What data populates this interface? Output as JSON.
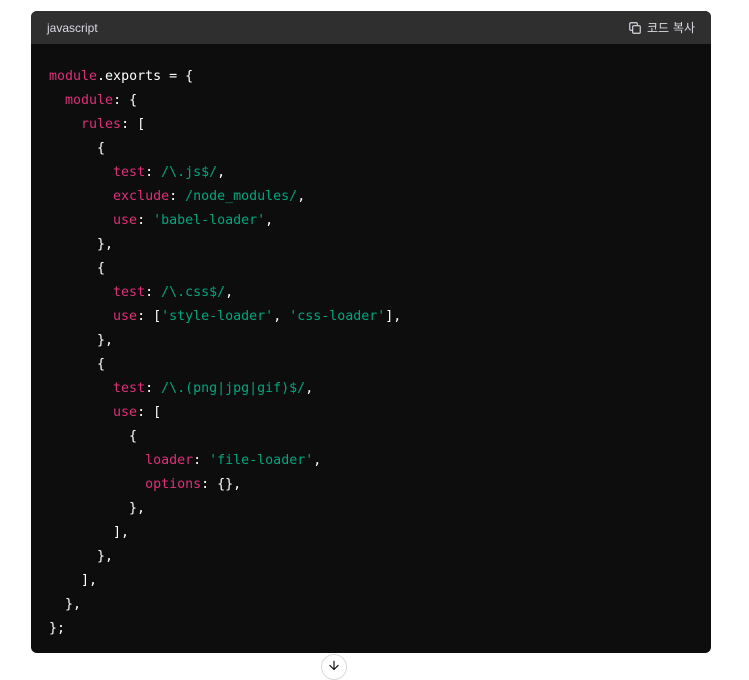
{
  "code_block": {
    "language": "javascript",
    "copy_label": "코드 복사",
    "lines": [
      [
        {
          "t": "prop",
          "v": "module"
        },
        {
          "t": "plain",
          "v": ".exports = {"
        }
      ],
      [
        {
          "t": "plain",
          "v": "  "
        },
        {
          "t": "prop",
          "v": "module"
        },
        {
          "t": "plain",
          "v": ": {"
        }
      ],
      [
        {
          "t": "plain",
          "v": "    "
        },
        {
          "t": "prop",
          "v": "rules"
        },
        {
          "t": "plain",
          "v": ": ["
        }
      ],
      [
        {
          "t": "plain",
          "v": "      {"
        }
      ],
      [
        {
          "t": "plain",
          "v": "        "
        },
        {
          "t": "prop",
          "v": "test"
        },
        {
          "t": "plain",
          "v": ": "
        },
        {
          "t": "str",
          "v": "/\\.js$/"
        },
        {
          "t": "plain",
          "v": ","
        }
      ],
      [
        {
          "t": "plain",
          "v": "        "
        },
        {
          "t": "prop",
          "v": "exclude"
        },
        {
          "t": "plain",
          "v": ": "
        },
        {
          "t": "str",
          "v": "/node_modules/"
        },
        {
          "t": "plain",
          "v": ","
        }
      ],
      [
        {
          "t": "plain",
          "v": "        "
        },
        {
          "t": "prop",
          "v": "use"
        },
        {
          "t": "plain",
          "v": ": "
        },
        {
          "t": "str",
          "v": "'babel-loader'"
        },
        {
          "t": "plain",
          "v": ","
        }
      ],
      [
        {
          "t": "plain",
          "v": "      },"
        }
      ],
      [
        {
          "t": "plain",
          "v": "      {"
        }
      ],
      [
        {
          "t": "plain",
          "v": "        "
        },
        {
          "t": "prop",
          "v": "test"
        },
        {
          "t": "plain",
          "v": ": "
        },
        {
          "t": "str",
          "v": "/\\.css$/"
        },
        {
          "t": "plain",
          "v": ","
        }
      ],
      [
        {
          "t": "plain",
          "v": "        "
        },
        {
          "t": "prop",
          "v": "use"
        },
        {
          "t": "plain",
          "v": ": ["
        },
        {
          "t": "str",
          "v": "'style-loader'"
        },
        {
          "t": "plain",
          "v": ", "
        },
        {
          "t": "str",
          "v": "'css-loader'"
        },
        {
          "t": "plain",
          "v": "],"
        }
      ],
      [
        {
          "t": "plain",
          "v": "      },"
        }
      ],
      [
        {
          "t": "plain",
          "v": "      {"
        }
      ],
      [
        {
          "t": "plain",
          "v": "        "
        },
        {
          "t": "prop",
          "v": "test"
        },
        {
          "t": "plain",
          "v": ": "
        },
        {
          "t": "str",
          "v": "/\\.(png|jpg|gif)$/"
        },
        {
          "t": "plain",
          "v": ","
        }
      ],
      [
        {
          "t": "plain",
          "v": "        "
        },
        {
          "t": "prop",
          "v": "use"
        },
        {
          "t": "plain",
          "v": ": ["
        }
      ],
      [
        {
          "t": "plain",
          "v": "          {"
        }
      ],
      [
        {
          "t": "plain",
          "v": "            "
        },
        {
          "t": "prop",
          "v": "loader"
        },
        {
          "t": "plain",
          "v": ": "
        },
        {
          "t": "str",
          "v": "'file-loader'"
        },
        {
          "t": "plain",
          "v": ","
        }
      ],
      [
        {
          "t": "plain",
          "v": "            "
        },
        {
          "t": "prop",
          "v": "options"
        },
        {
          "t": "plain",
          "v": ": {},"
        }
      ],
      [
        {
          "t": "plain",
          "v": "          },"
        }
      ],
      [
        {
          "t": "plain",
          "v": "        ],"
        }
      ],
      [
        {
          "t": "plain",
          "v": "      },"
        }
      ],
      [
        {
          "t": "plain",
          "v": "    ],"
        }
      ],
      [
        {
          "t": "plain",
          "v": "  },"
        }
      ],
      [
        {
          "t": "plain",
          "v": "};"
        }
      ]
    ]
  },
  "icons": {
    "copy": "copy-icon",
    "scroll_down": "arrow-down-icon"
  },
  "colors": {
    "code_bg": "#0d0d0d",
    "header_bg": "#2f2f2f",
    "property": "#df3079",
    "string": "#00a67d",
    "plain": "#ffffff"
  }
}
